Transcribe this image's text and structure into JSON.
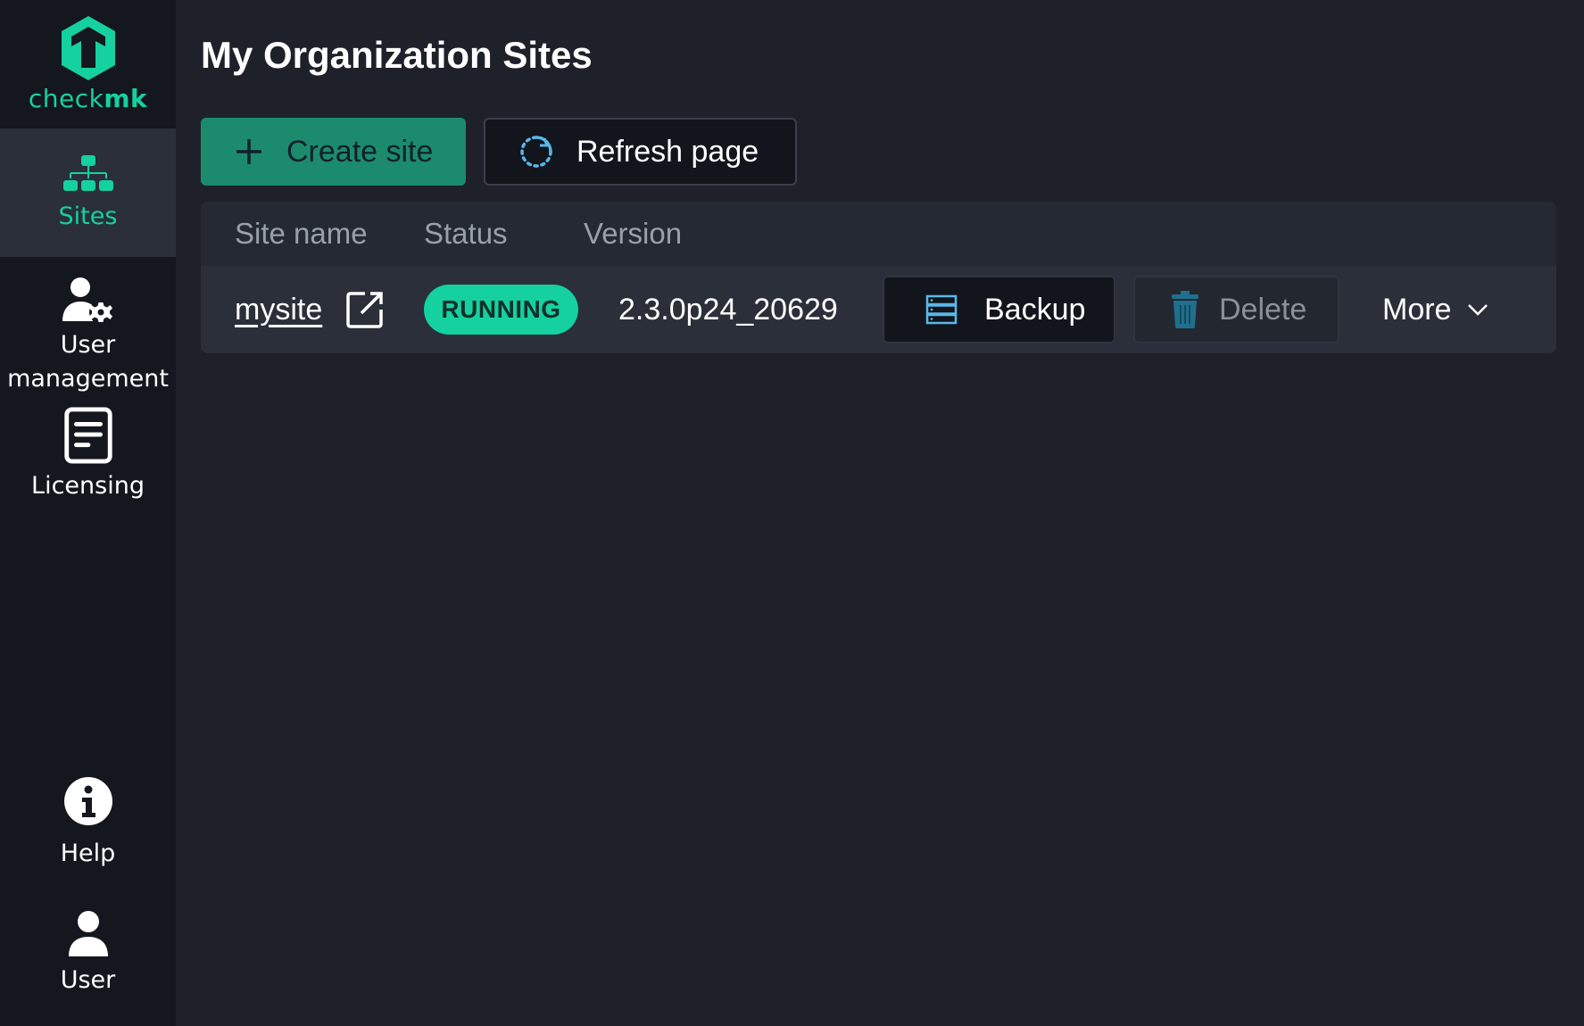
{
  "brand": {
    "name_light": "check",
    "name_bold": "mk",
    "accent": "#15d1a0"
  },
  "sidebar": {
    "items": [
      {
        "label": "Sites",
        "icon": "sitemap-icon",
        "active": true
      },
      {
        "label": "User management",
        "line1": "User",
        "line2": "management",
        "icon": "user-gear-icon"
      },
      {
        "label": "Licensing",
        "icon": "document-icon"
      }
    ],
    "bottom": [
      {
        "label": "Help",
        "icon": "info-icon"
      },
      {
        "label": "User",
        "icon": "user-icon"
      }
    ]
  },
  "page": {
    "title": "My Organization Sites"
  },
  "toolbar": {
    "create_label": "Create site",
    "refresh_label": "Refresh page"
  },
  "table": {
    "columns": [
      "Site name",
      "Status",
      "Version"
    ],
    "rows": [
      {
        "site_name": "mysite",
        "status": "RUNNING",
        "version": "2.3.0p24_20629",
        "backup_label": "Backup",
        "delete_label": "Delete",
        "more_label": "More"
      }
    ]
  },
  "colors": {
    "background": "#1e2129",
    "sidebar": "#14171e",
    "sidebar_active": "#2a2f39",
    "create_button": "#1c8b6d",
    "status_running": "#15d1a0",
    "backup_icon": "#5ab8e8",
    "delete_icon": "#1f6f8f"
  }
}
